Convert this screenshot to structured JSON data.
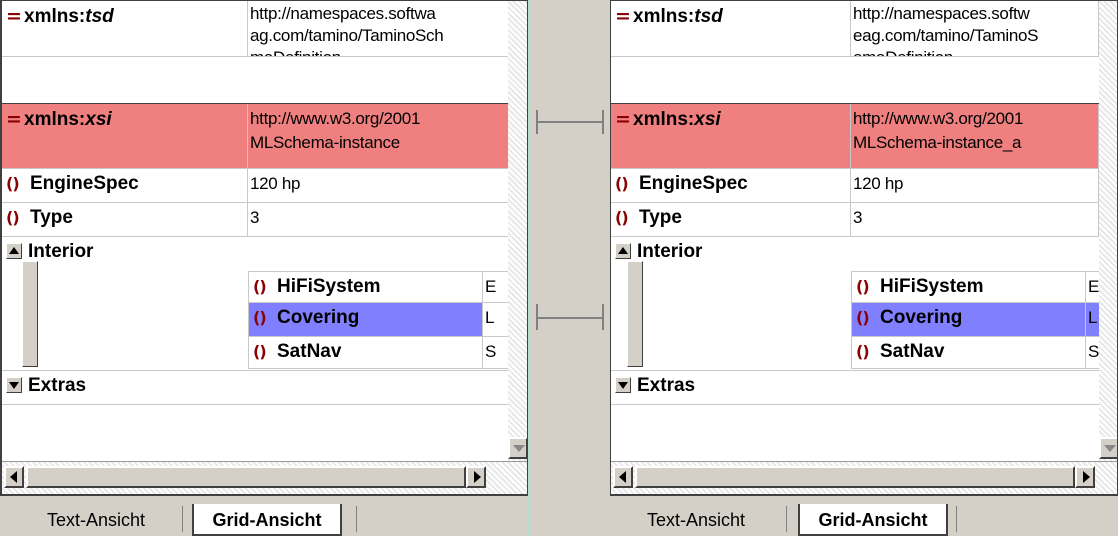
{
  "left": {
    "rows": {
      "xmlns_tsd": {
        "icon": "=",
        "prefix": "xmlns:",
        "name_italic": "tsd",
        "value_lines": [
          "http://namespaces.softwa",
          "ag.com/tamino/TaminoSch",
          "maDefinition"
        ]
      },
      "xmlns_xsi": {
        "icon": "=",
        "prefix": "xmlns:",
        "name_italic": "xsi",
        "value_lines": [
          "http://www.w3.org/2001",
          "MLSchema-instance"
        ]
      },
      "enginespec": {
        "icon": "()",
        "name": "EngineSpec",
        "value": "120 hp"
      },
      "type": {
        "icon": "()",
        "name": "Type",
        "value": "3"
      },
      "interior": {
        "name": "Interior"
      },
      "hifisystem": {
        "icon": "()",
        "name": "HiFiSystem",
        "value": "E"
      },
      "covering": {
        "icon": "()",
        "name": "Covering",
        "value": "L"
      },
      "satnav": {
        "icon": "()",
        "name": "SatNav",
        "value": "S"
      },
      "extras": {
        "name": "Extras"
      }
    },
    "tabs": {
      "text_view": "Text-Ansicht",
      "grid_view": "Grid-Ansicht"
    }
  },
  "right": {
    "rows": {
      "xmlns_tsd": {
        "icon": "=",
        "prefix": "xmlns:",
        "name_italic": "tsd",
        "value_lines": [
          "http://namespaces.softw",
          "eag.com/tamino/TaminoS",
          "emaDefinition"
        ]
      },
      "xmlns_xsi": {
        "icon": "=",
        "prefix": "xmlns:",
        "name_italic": "xsi",
        "value_lines": [
          "http://www.w3.org/2001",
          "MLSchema-instance_a"
        ]
      },
      "enginespec": {
        "icon": "()",
        "name": "EngineSpec",
        "value": "120 hp"
      },
      "type": {
        "icon": "()",
        "name": "Type",
        "value": "3"
      },
      "interior": {
        "name": "Interior"
      },
      "hifisystem": {
        "icon": "()",
        "name": "HiFiSystem",
        "value": "E"
      },
      "covering": {
        "icon": "()",
        "name": "Covering",
        "value": "L"
      },
      "satnav": {
        "icon": "()",
        "name": "SatNav",
        "value": "S"
      },
      "extras": {
        "name": "Extras"
      }
    },
    "tabs": {
      "text_view": "Text-Ansicht",
      "grid_view": "Grid-Ansicht"
    }
  },
  "colors": {
    "diff_attribute": "#f08080",
    "diff_element": "#8080ff",
    "element_icon": "#8b0000"
  },
  "icons": {
    "attribute": "equals-icon",
    "element": "braces-icon",
    "collapse": "triangle-up-icon",
    "expand": "triangle-down-icon"
  }
}
